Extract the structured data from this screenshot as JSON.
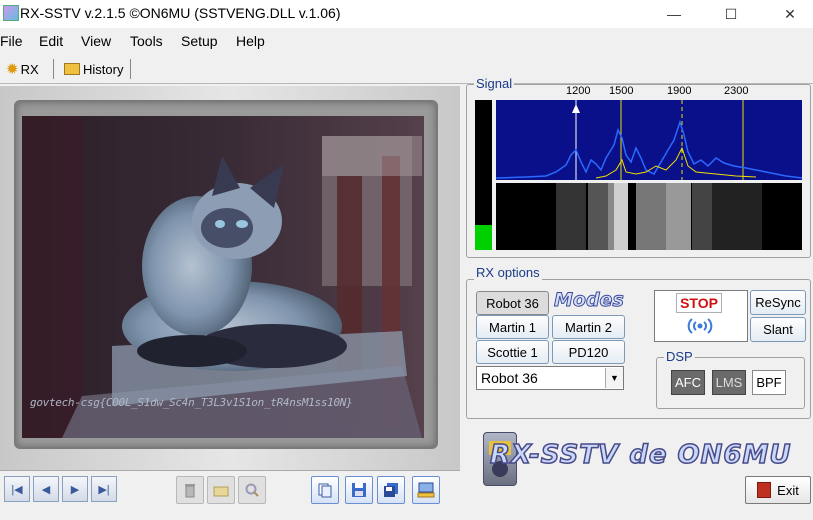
{
  "window": {
    "title": "RX-SSTV v.2.1.5 ©ON6MU (SSTVENG.DLL v.1.06)",
    "minimize_glyph": "—",
    "maximize_glyph": "☐",
    "close_glyph": "✕"
  },
  "menu": [
    "File",
    "Edit",
    "View",
    "Tools",
    "Setup",
    "Help"
  ],
  "tabs": [
    {
      "label": "RX",
      "icon": "gear-icon",
      "active": true
    },
    {
      "label": "History",
      "icon": "folder-icon",
      "active": false
    }
  ],
  "image": {
    "caption": "govtech-csg{C00L_S1dw_Sc4n_T3L3v1S1on_tR4nsM1ss10N}",
    "subject": "cat-photo"
  },
  "nav_buttons": [
    {
      "name": "first",
      "glyph": "|◀"
    },
    {
      "name": "prev",
      "glyph": "◀"
    },
    {
      "name": "next",
      "glyph": "▶"
    },
    {
      "name": "last",
      "glyph": "▶|"
    }
  ],
  "signal": {
    "label": "Signal",
    "freq_ticks": [
      "1200",
      "1500",
      "1900",
      "2300"
    ],
    "level": 0.17
  },
  "rx_options": {
    "label": "RX options",
    "modes_logo": "Modes",
    "mode_buttons": [
      "Robot 36",
      "Martin 1",
      "Martin 2",
      "Scottie 1",
      "PD120"
    ],
    "selected_mode": "Robot 36",
    "dropdown_value": "Robot 36",
    "stop_label": "STOP",
    "resync_label": "ReSync",
    "slant_label": "Slant"
  },
  "dsp": {
    "label": "DSP",
    "afc": "AFC",
    "lms": "LMS",
    "bpf": "BPF"
  },
  "logo_text": "RX-SSTV de ON6MU",
  "exit_label": "Exit",
  "colors": {
    "accent": "#1a3a8a",
    "spectrum_bg": "#0a0f8a",
    "level_green": "#00d000",
    "stop_red": "#d01010"
  }
}
